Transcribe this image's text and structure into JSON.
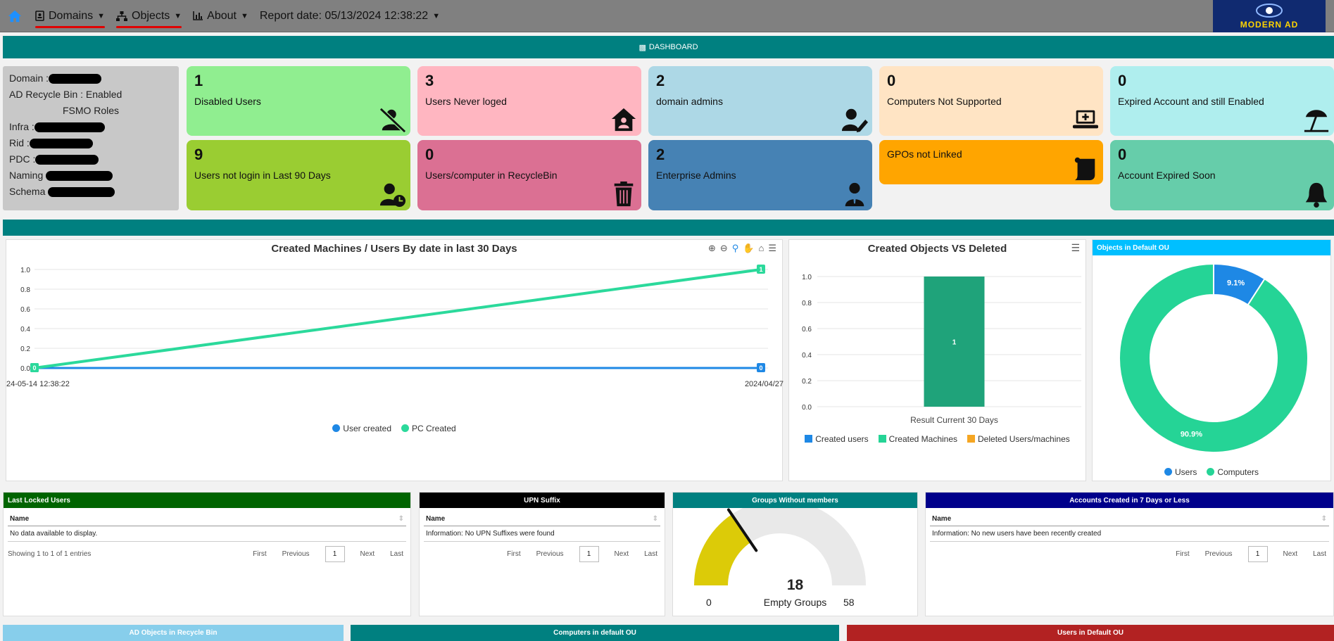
{
  "nav": {
    "domains": "Domains",
    "objects": "Objects",
    "about": "About",
    "report_date": "Report date: 05/13/2024 12:38:22",
    "logo_text": "MODERN AD"
  },
  "dashboard": {
    "label": "DASHBOARD"
  },
  "info": {
    "domain": "Domain :",
    "recycle": "AD Recycle Bin : Enabled",
    "fsmo": "FSMO Roles",
    "infra": "Infra :",
    "rid": "Rid :",
    "pdc": "PDC :",
    "naming": "Naming",
    "schema": "Schema"
  },
  "cards": [
    {
      "value": "1",
      "label": "Disabled Users",
      "color": "#90ee90",
      "icon": "user-slash-icon"
    },
    {
      "value": "3",
      "label": "Users Never loged",
      "color": "#ffb6c1",
      "icon": "house-user-icon"
    },
    {
      "value": "2",
      "label": "domain admins",
      "color": "#add8e6",
      "icon": "user-edit-icon"
    },
    {
      "value": "0",
      "label": "Computers Not Supported",
      "color": "#ffe4c4",
      "icon": "laptop-medical-icon"
    },
    {
      "value": "0",
      "label": "Expired Account and still Enabled",
      "color": "#afeeee",
      "icon": "umbrella-beach-icon"
    },
    {
      "value": "9",
      "label": "Users not login in Last 90 Days",
      "color": "#9acd32",
      "icon": "user-clock-icon"
    },
    {
      "value": "0",
      "label": "Users/computer in RecycleBin",
      "color": "#db7093",
      "icon": "trash-icon"
    },
    {
      "value": "2",
      "label": "Enterprise Admins",
      "color": "#4682b4",
      "icon": "user-tie-icon"
    },
    {
      "value": "",
      "label": "GPOs not Linked",
      "color": "#ffa500",
      "icon": "scroll-icon"
    },
    {
      "value": "0",
      "label": "Account Expired Soon",
      "color": "#66cdaa",
      "icon": "bell-icon"
    }
  ],
  "chart_data": [
    {
      "type": "line",
      "title": "Created Machines / Users By date in last 30 Days",
      "x": [
        "24-05-14 12:38:22",
        "2024/04/27"
      ],
      "ylim": [
        0,
        1
      ],
      "yticks": [
        "0.0",
        "0.2",
        "0.4",
        "0.6",
        "0.8",
        "1.0"
      ],
      "series": [
        {
          "name": "User created",
          "values": [
            0,
            0
          ],
          "color": "#1e88e5"
        },
        {
          "name": "PC Created",
          "values": [
            0,
            1
          ],
          "color": "#2bd99b"
        }
      ],
      "legend": "bottom"
    },
    {
      "type": "bar",
      "title": "Created Objects VS Deleted",
      "categories": [
        "Result Current 30 Days"
      ],
      "ylim": [
        0,
        1
      ],
      "yticks": [
        "0.0",
        "0.2",
        "0.4",
        "0.6",
        "0.8",
        "1.0"
      ],
      "series": [
        {
          "name": "Created users",
          "values": [
            0
          ],
          "color": "#1e88e5"
        },
        {
          "name": "Created Machines",
          "values": [
            1
          ],
          "color": "#1fa37a"
        },
        {
          "name": "Deleted Users/machines",
          "values": [
            0
          ],
          "color": "#f5a623"
        }
      ],
      "legend": "bottom"
    },
    {
      "type": "pie",
      "title": "Objects in Default OU",
      "series": [
        {
          "name": "Users",
          "value": 9.1,
          "label": "9.1%",
          "color": "#1e88e5"
        },
        {
          "name": "Computers",
          "value": 90.9,
          "label": "90.9%",
          "color": "#25d496"
        }
      ],
      "legend": "bottom"
    }
  ],
  "tables": {
    "locked": {
      "title": "Last Locked Users",
      "col": "Name",
      "row": "No data available to display.",
      "footer": "Showing 1 to 1 of 1 entries"
    },
    "upn": {
      "title": "UPN Suffix",
      "col": "Name",
      "row": "Information: No UPN Suffixes were found"
    },
    "groups": {
      "title": "Groups Without members",
      "value": "18",
      "label": "Empty Groups",
      "min": "0",
      "max": "58",
      "fraction": 0.31
    },
    "accounts": {
      "title": "Accounts Created in 7 Days or Less",
      "col": "Name",
      "row": "Information: No new users have been recently created"
    }
  },
  "pager": {
    "first": "First",
    "previous": "Previous",
    "page": "1",
    "next": "Next",
    "last": "Last"
  },
  "bottom": {
    "recycle": "AD Objects in Recycle Bin",
    "computers": "Computers in default OU",
    "users": "Users in Default OU"
  }
}
